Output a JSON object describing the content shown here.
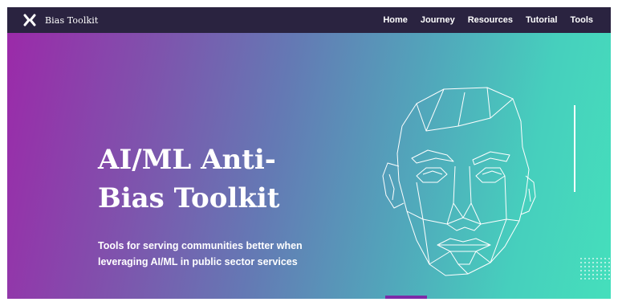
{
  "brand": {
    "name": "Bias Toolkit",
    "icon": "x-logo-icon"
  },
  "nav": {
    "links": [
      "Home",
      "Journey",
      "Resources",
      "Tutorial",
      "Tools"
    ]
  },
  "hero": {
    "title_line1": "AI/ML Anti-",
    "title_line2": "Bias Toolkit",
    "subtitle_line1": "Tools for serving communities better when",
    "subtitle_line2": "leveraging AI/ML in public sector services",
    "illustration": "wireframe-face-illustration",
    "carousel_indicator": "slide-indicator"
  },
  "colors": {
    "navbar": "#2a2340",
    "gradient_start": "#9b2aa9",
    "gradient_end": "#45dfbc",
    "indicator": "#7c2aa8",
    "text": "#ffffff"
  }
}
